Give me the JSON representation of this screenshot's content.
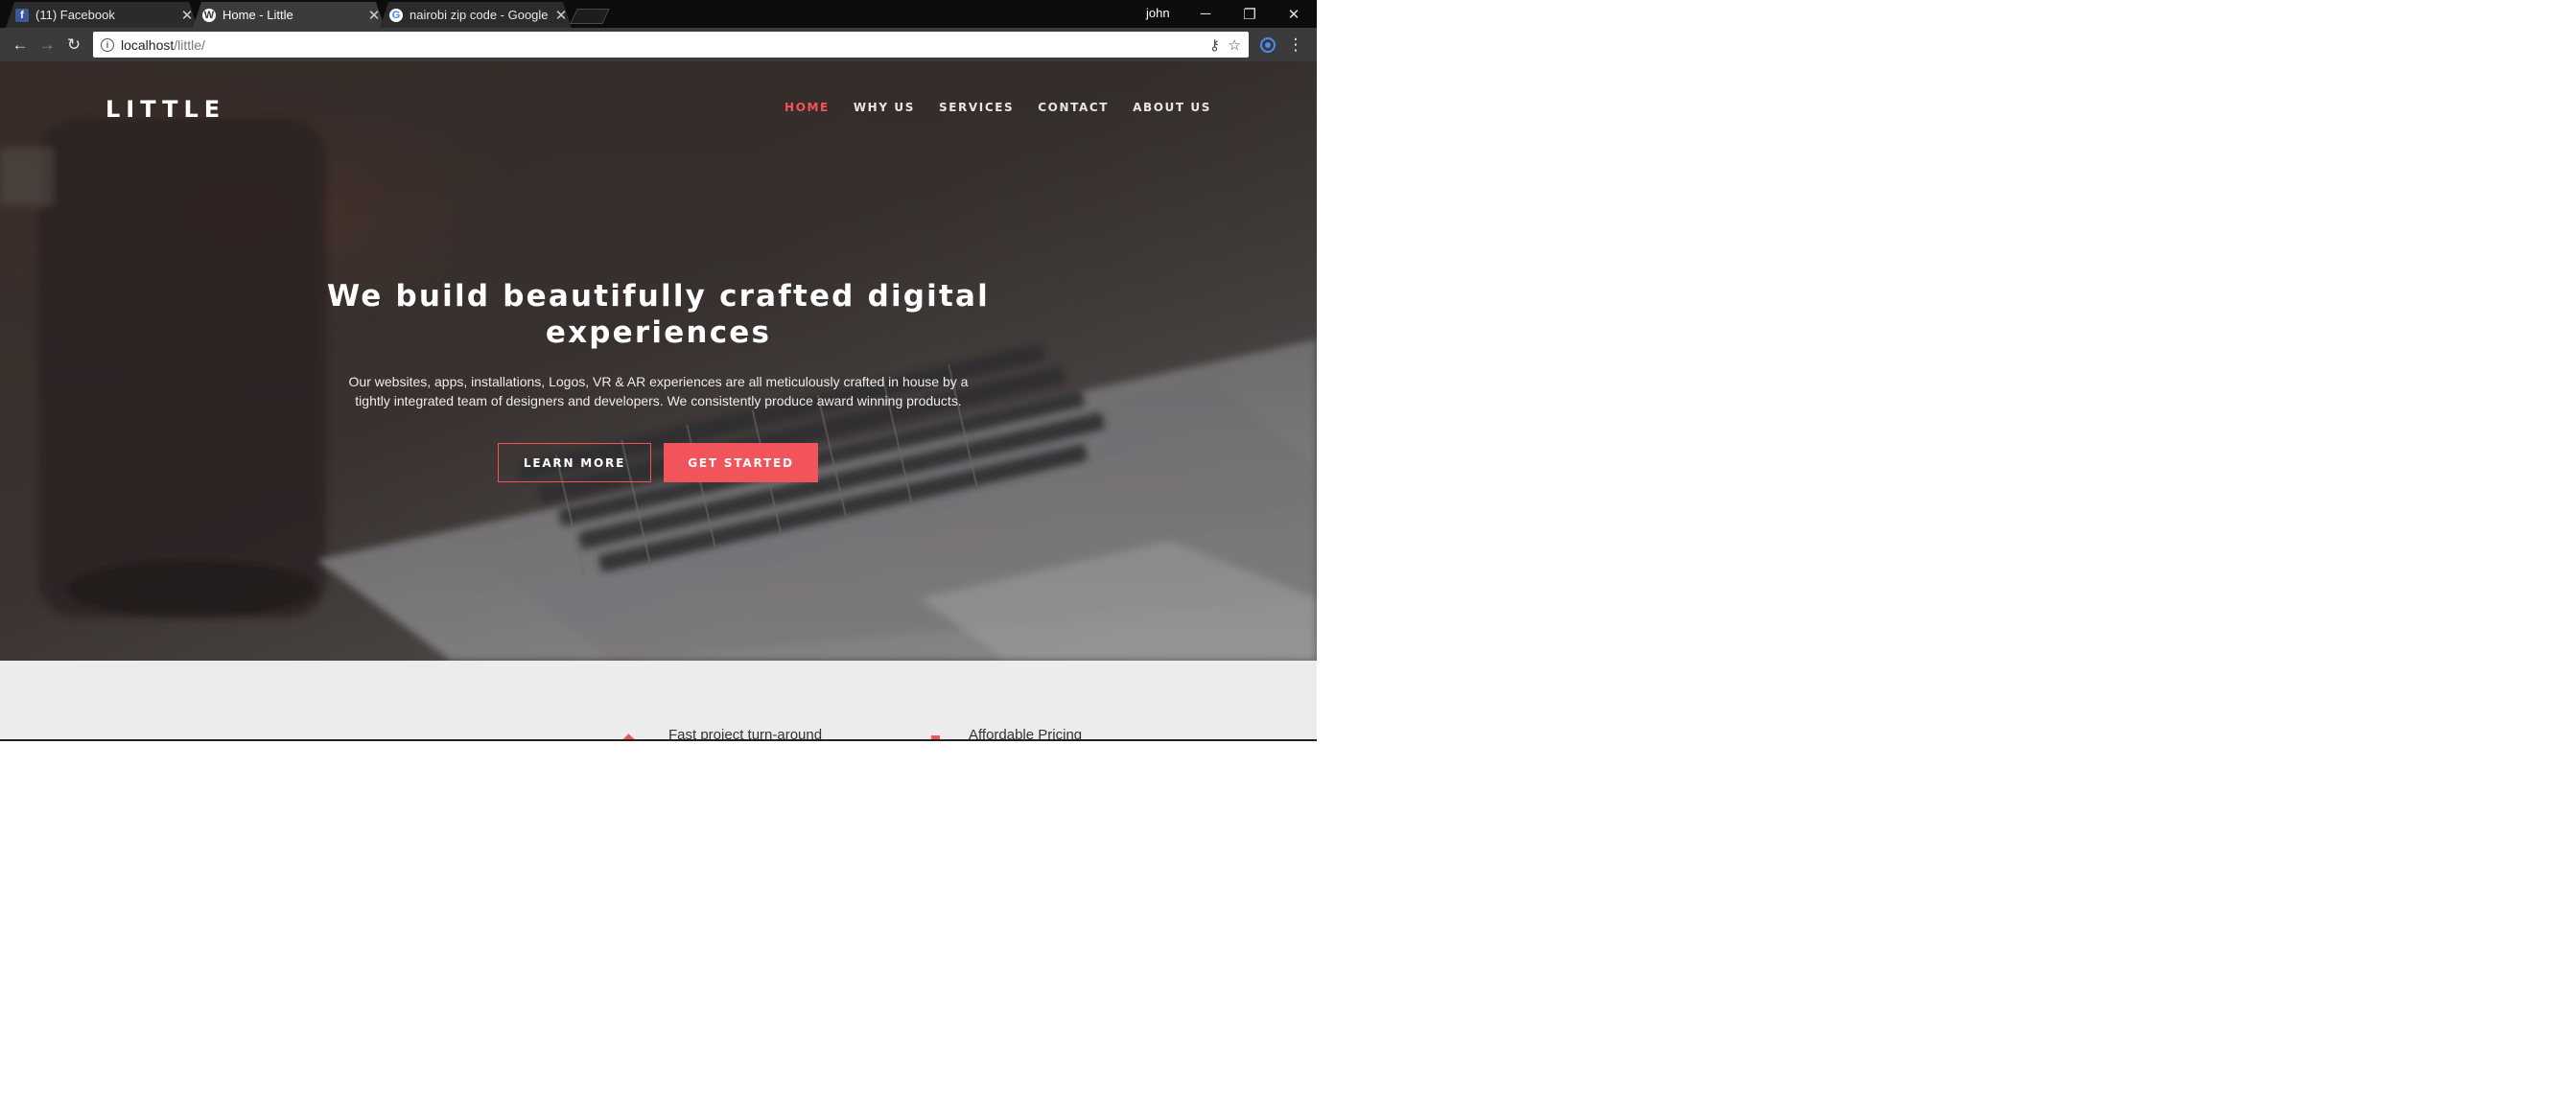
{
  "browser": {
    "tabs": [
      {
        "title": "(11) Facebook",
        "icon": "facebook-icon",
        "active": false
      },
      {
        "title": "Home - Little",
        "icon": "wordpress-icon",
        "active": true
      },
      {
        "title": "nairobi zip code - Google",
        "icon": "google-icon",
        "active": false
      }
    ],
    "user": "john",
    "address": {
      "host": "localhost",
      "path": "/little/"
    }
  },
  "site": {
    "logo": "LITTLE",
    "nav": [
      "HOME",
      "WHY US",
      "SERVICES",
      "CONTACT",
      "ABOUT US"
    ],
    "active_nav": "HOME",
    "hero": {
      "title": "We build beautifully crafted digital experiences",
      "description_line1": "Our websites, apps, installations, Logos, VR & AR experiences are all meticulously crafted in house by a",
      "description_line2": "tightly integrated team of designers and developers. We consistently produce award winning products.",
      "buttons": {
        "learn_more": "LEARN MORE",
        "get_started": "GET STARTED"
      }
    },
    "features": [
      "Fast project turn-around",
      "Affordable Pricing"
    ]
  },
  "colors": {
    "accent": "#f2545b",
    "hero_bg": "#3a3330",
    "section_bg": "#ececec"
  }
}
